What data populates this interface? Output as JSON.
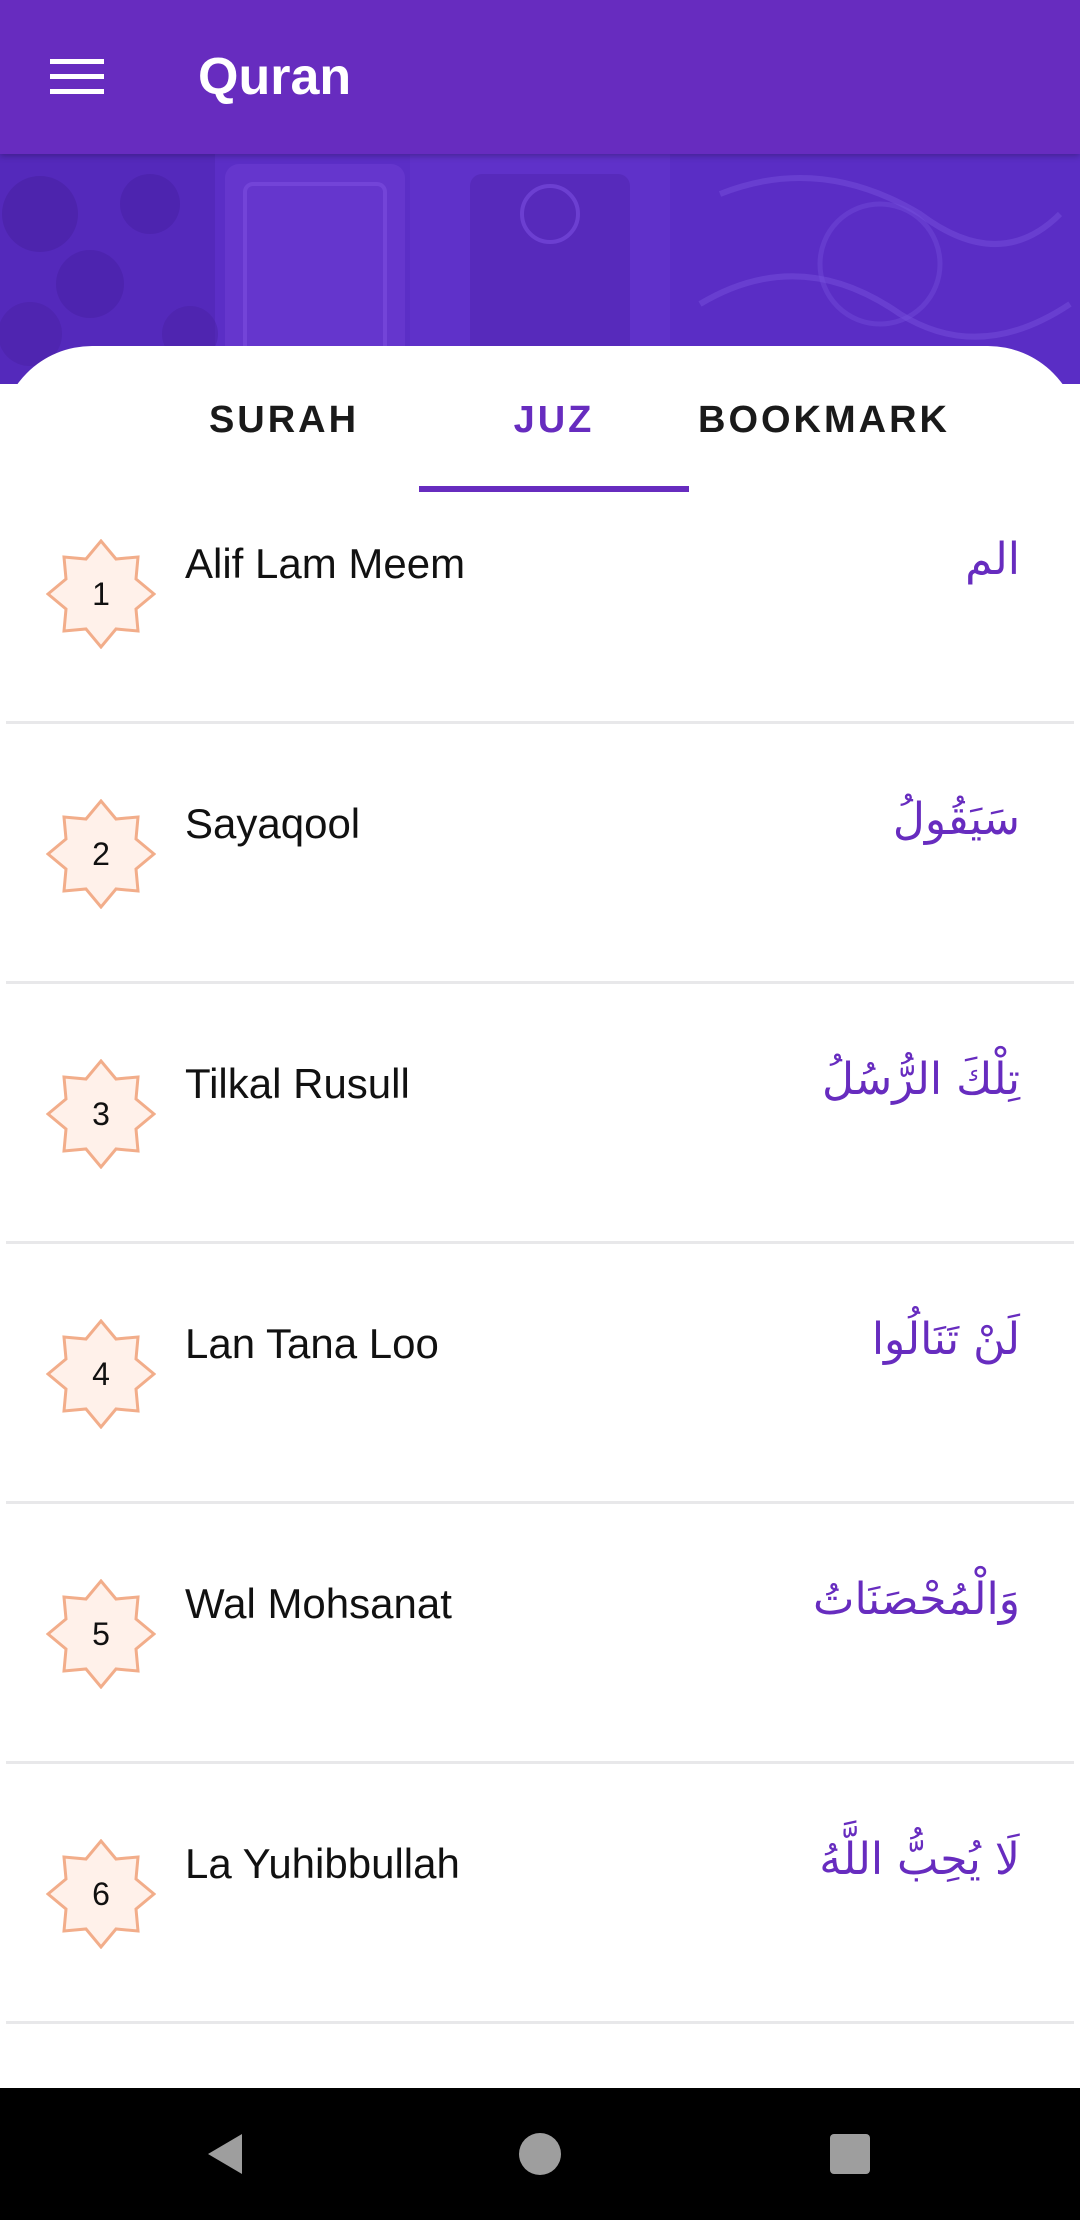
{
  "app": {
    "title": "Quran",
    "accent_color": "#672cbf"
  },
  "tabs": [
    {
      "label": "SURAH",
      "active": false
    },
    {
      "label": "JUZ",
      "active": true
    },
    {
      "label": "BOOKMARK",
      "active": false
    }
  ],
  "juz_list": [
    {
      "number": "1",
      "name": "Alif Lam Meem",
      "arabic": "الم"
    },
    {
      "number": "2",
      "name": "Sayaqool",
      "arabic": "سَيَقُولُ"
    },
    {
      "number": "3",
      "name": "Tilkal Rusull",
      "arabic": "تِلْكَ الرُّسُلُ"
    },
    {
      "number": "4",
      "name": "Lan Tana Loo",
      "arabic": "لَنْ تَنَالُوا"
    },
    {
      "number": "5",
      "name": "Wal Mohsanat",
      "arabic": "وَالْمُحْصَنَاتُ"
    },
    {
      "number": "6",
      "name": "La Yuhibbullah",
      "arabic": "لَا يُحِبُّ اللَّهُ"
    }
  ],
  "icons": {
    "menu": "hamburger-menu-icon",
    "badge": "eight-point-star-icon",
    "back": "back-triangle-icon",
    "home": "home-circle-icon",
    "recents": "recents-square-icon"
  },
  "colors": {
    "badge_stroke": "#f2ad8a",
    "badge_fill": "#fff1ea",
    "divider": "#e8e8ea",
    "banner": "#5a2fc9"
  }
}
